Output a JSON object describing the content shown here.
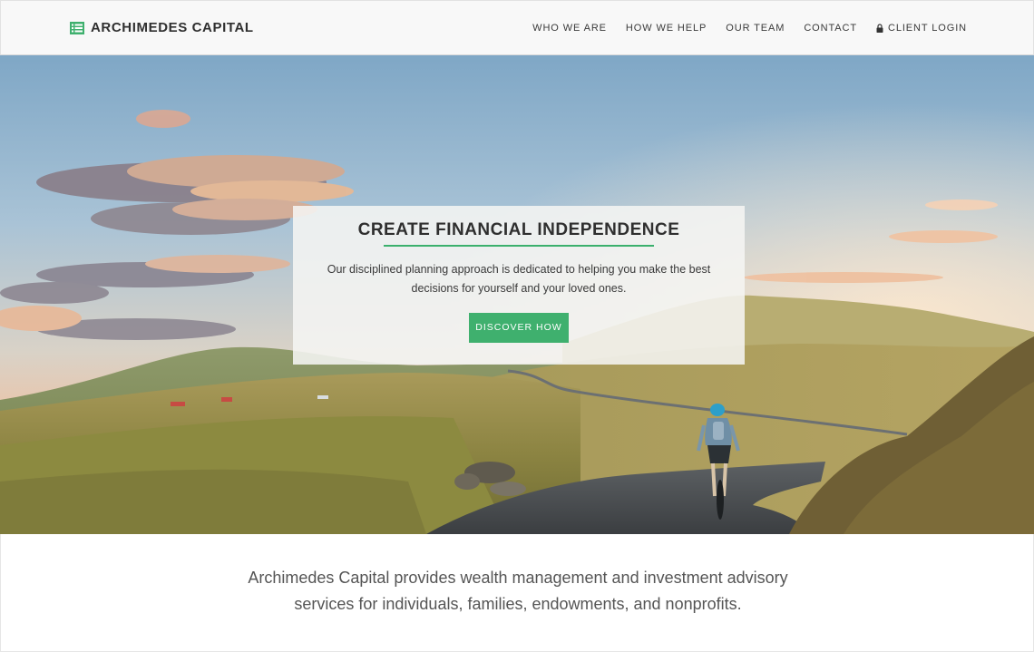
{
  "header": {
    "brand": "ARCHIMEDES CAPITAL",
    "brand_icon": "list-icon",
    "nav": [
      {
        "label": "WHO WE ARE"
      },
      {
        "label": "HOW WE HELP"
      },
      {
        "label": "OUR TEAM"
      },
      {
        "label": "CONTACT"
      },
      {
        "label": "CLIENT LOGIN",
        "icon": "lock-icon"
      }
    ]
  },
  "hero": {
    "title": "CREATE FINANCIAL INDEPENDENCE",
    "text": "Our disciplined planning approach is dedicated to helping you make the best decisions for yourself and your loved ones.",
    "button": "DISCOVER HOW",
    "background": "cyclist on mountain road at sunset"
  },
  "intro": {
    "text": "Archimedes Capital provides wealth management and investment advisory services for individuals, families, endowments, and nonprofits."
  },
  "colors": {
    "accent": "#3fb06e",
    "header_bg": "#f8f8f8",
    "text_dark": "#2f2f2f"
  }
}
